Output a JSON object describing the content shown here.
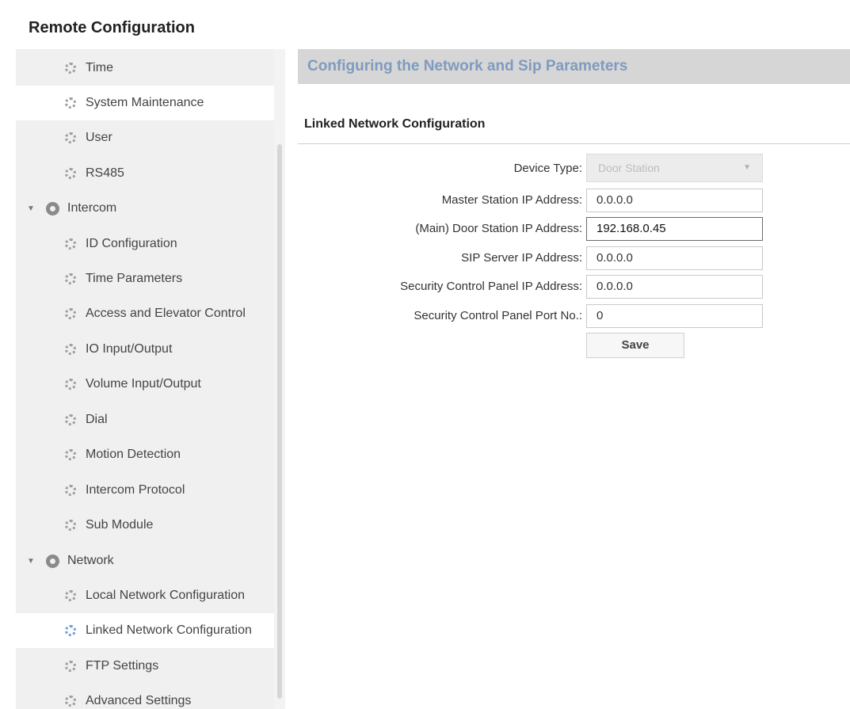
{
  "window": {
    "title": "Remote Configuration"
  },
  "sidebar": {
    "items": [
      {
        "label": "Time",
        "level": 1
      },
      {
        "label": "System Maintenance",
        "level": 1
      },
      {
        "label": "User",
        "level": 1
      },
      {
        "label": "RS485",
        "level": 1
      },
      {
        "label": "Intercom",
        "level": 0
      },
      {
        "label": "ID Configuration",
        "level": 1
      },
      {
        "label": "Time Parameters",
        "level": 1
      },
      {
        "label": "Access and Elevator Control",
        "level": 1
      },
      {
        "label": "IO Input/Output",
        "level": 1
      },
      {
        "label": "Volume Input/Output",
        "level": 1
      },
      {
        "label": "Dial",
        "level": 1
      },
      {
        "label": "Motion Detection",
        "level": 1
      },
      {
        "label": "Intercom Protocol",
        "level": 1
      },
      {
        "label": "Sub Module",
        "level": 1
      },
      {
        "label": "Network",
        "level": 0
      },
      {
        "label": "Local Network Configuration",
        "level": 1
      },
      {
        "label": "Linked Network Configuration",
        "level": 1
      },
      {
        "label": "FTP Settings",
        "level": 1
      },
      {
        "label": "Advanced Settings",
        "level": 1
      }
    ]
  },
  "main": {
    "header": "Configuring the Network and Sip Parameters",
    "section_title": "Linked Network Configuration",
    "fields": {
      "device_type": {
        "label": "Device Type:",
        "value": "Door Station"
      },
      "master_ip": {
        "label": "Master Station IP Address:",
        "value": "0.0.0.0"
      },
      "door_ip": {
        "label": "(Main) Door Station IP Address:",
        "value": "192.168.0.45"
      },
      "sip_ip": {
        "label": "SIP Server IP Address:",
        "value": "0.0.0.0"
      },
      "panel_ip": {
        "label": "Security Control Panel IP Address:",
        "value": "0.0.0.0"
      },
      "panel_port": {
        "label": "Security Control Panel Port No.:",
        "value": "0"
      }
    },
    "save_label": "Save"
  },
  "colors": {
    "header_bg": "#d6d6d6",
    "header_text": "#7f9bbf",
    "sidebar_bg": "#f0f0f0",
    "selected_bg": "#ffffff"
  },
  "icons": {
    "tree_leaf": "gear-icon",
    "tree_group": "globe-icon",
    "expander": "caret-down-icon",
    "select_arrow": "chevron-down-icon"
  }
}
